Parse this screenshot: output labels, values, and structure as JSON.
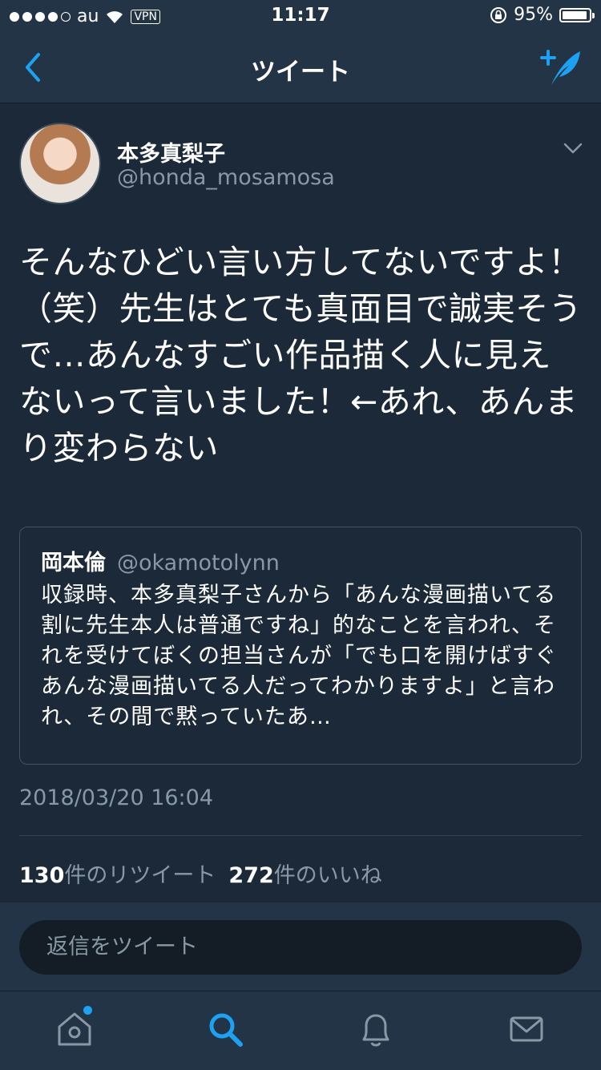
{
  "status_bar": {
    "carrier": "au",
    "vpn": "VPN",
    "time": "11:17",
    "battery": "95%",
    "battery_level": 0.95
  },
  "nav": {
    "title": "ツイート"
  },
  "tweet": {
    "display_name": "本多真梨子",
    "handle": "@honda_mosamosa",
    "text": "そんなひどい言い方してないですよ！（笑）先生はとても真面目で誠実そうで…あんなすごい作品描く人に見えないって言いました！←あれ、あんまり変わらない",
    "quote": {
      "display_name": "岡本倫",
      "handle": "@okamotolynn",
      "text": "収録時、本多真梨子さんから「あんな漫画描いてる割に先生本人は普通ですね」的なことを言われ、それを受けてぼくの担当さんが「でも口を開けばすぐあんな漫画描いてる人だってわかりますよ」と言われ、その間で黙っていたあ…"
    },
    "timestamp": "2018/03/20 16:04",
    "retweet_count": "130",
    "retweet_label": "件のリツイート",
    "like_count": "272",
    "like_label": "件のいいね"
  },
  "reply": {
    "placeholder": "返信をツイート"
  },
  "tab_bar": {
    "tabs": [
      {
        "name": "home",
        "icon": "home-icon"
      },
      {
        "name": "search",
        "icon": "search-icon",
        "active": true
      },
      {
        "name": "notifications",
        "icon": "bell-icon"
      },
      {
        "name": "messages",
        "icon": "envelope-icon"
      }
    ]
  },
  "colors": {
    "background": "#1c2938",
    "bar": "#243447",
    "accent": "#1da1f2",
    "secondary_text": "#8899a6"
  }
}
